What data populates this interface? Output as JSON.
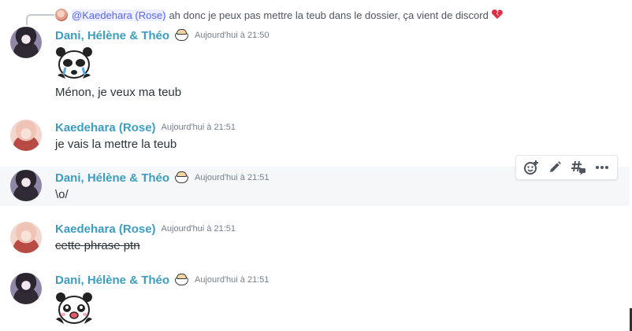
{
  "reply": {
    "mention": "@Kaedehara (Rose)",
    "text": "ah donc je peux pas mettre la teub dans le dossier, ça vient de discord",
    "emoji_icon": "broken-heart-icon"
  },
  "messages": [
    {
      "author": "Dani, Hélène & Théo",
      "badge_icon": "dumpling-icon",
      "timestamp": "Aujourd'hui à 21:50",
      "sticker": "crying-panda-sticker",
      "content": "Ménon, je veux ma teub",
      "strikethrough": false
    },
    {
      "author": "Kaedehara (Rose)",
      "timestamp": "Aujourd'hui à 21:51",
      "content": "je vais la mettre la teub",
      "strikethrough": false
    },
    {
      "author": "Dani, Hélène & Théo",
      "badge_icon": "dumpling-icon",
      "timestamp": "Aujourd'hui à 21:51",
      "content": "\\o/",
      "strikethrough": false
    },
    {
      "author": "Kaedehara (Rose)",
      "timestamp": "Aujourd'hui à 21:51",
      "content": "cette phrase ptn",
      "strikethrough": true
    },
    {
      "author": "Dani, Hélène & Théo",
      "badge_icon": "dumpling-icon",
      "timestamp": "Aujourd'hui à 21:51",
      "sticker": "happy-panda-sticker"
    }
  ],
  "toolbar": {
    "icons": [
      "add-reaction-icon",
      "edit-icon",
      "create-thread-icon",
      "more-options-icon"
    ]
  },
  "colors": {
    "username": "#3c9dc0",
    "mention": "#5865f2",
    "hover_background": "#f6f7f8",
    "timestamp": "#747f8d"
  }
}
